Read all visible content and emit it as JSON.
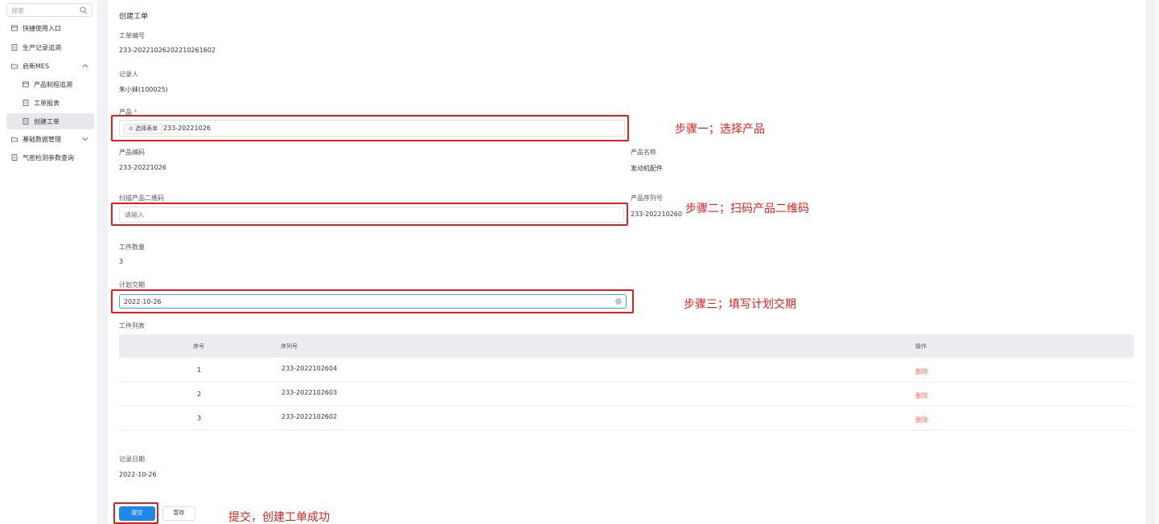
{
  "sidebar": {
    "search_placeholder": "搜索",
    "items": [
      {
        "label": "快捷使用入口"
      },
      {
        "label": "生产记录追溯"
      },
      {
        "label": "启新MES"
      },
      {
        "label": "产品制程追溯"
      },
      {
        "label": "工单报表"
      },
      {
        "label": "创建工单"
      },
      {
        "label": "基础数据管理"
      },
      {
        "label": "气密检测参数查询"
      }
    ]
  },
  "form": {
    "title": "创建工单",
    "order_no_label": "工单编号",
    "order_no": "233-20221026202210261602",
    "recorder_label": "记录人",
    "recorder": "朱小妹(100025)",
    "product_label": "产品",
    "required_mark": "*",
    "select_form_btn": "选择表单",
    "product_value": "233-20221026",
    "product_code_label": "产品编码",
    "product_code": "233-20221026",
    "product_name_label": "产品名称",
    "product_name": "发动机配件",
    "scan_label": "扫描产品二维码",
    "scan_placeholder": "请输入",
    "serial_label": "产品序列号",
    "serial_value": "233-202210260",
    "qty_label": "工件数量",
    "qty": "3",
    "due_label": "计划交期",
    "due_value": "2022-10-26",
    "list_label": "工件列表",
    "record_date_label": "记录日期",
    "record_date": "2022-10-26",
    "submit": "提交",
    "draft": "暂存"
  },
  "table": {
    "headers": [
      "序号",
      "序列号",
      "操作"
    ],
    "rows": [
      {
        "idx": "1",
        "serial": "233-2022102604",
        "action": "删除"
      },
      {
        "idx": "2",
        "serial": "233-2022102603",
        "action": "删除"
      },
      {
        "idx": "3",
        "serial": "233-2022102602",
        "action": "删除"
      }
    ]
  },
  "annotations": {
    "step1": "步骤一；选择产品",
    "step2": "步骤二；扫码产品二维码",
    "step3": "步骤三；填写计划交期",
    "step4": "提交，创建工单成功"
  },
  "colors": {
    "annotation": "#e02020",
    "primary": "#1f87e8",
    "danger": "#f56c6c"
  }
}
